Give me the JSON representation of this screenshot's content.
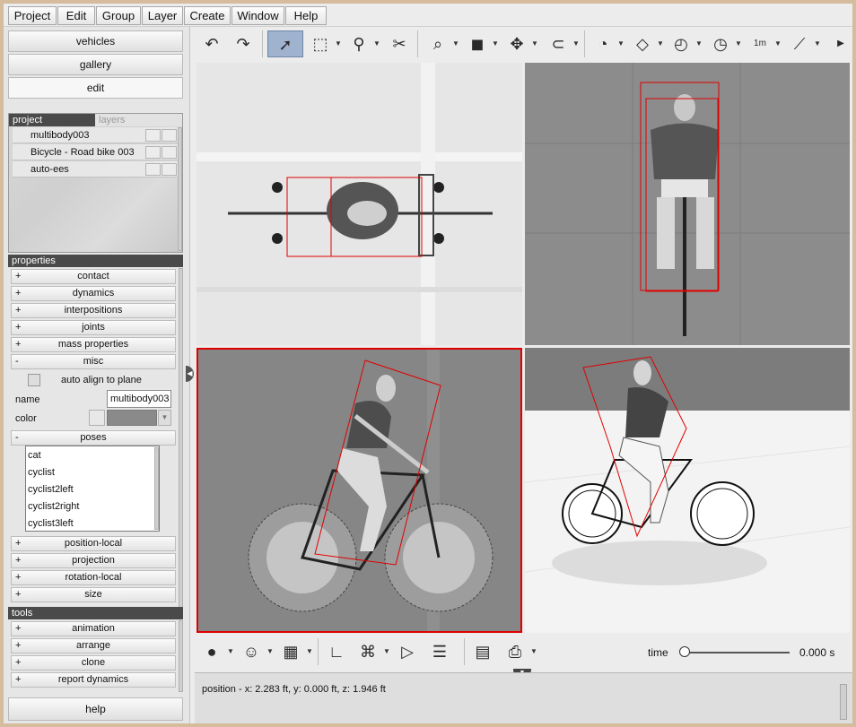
{
  "menubar": {
    "items": [
      "Project",
      "Edit",
      "Group",
      "Layer",
      "Create",
      "Window",
      "Help"
    ]
  },
  "sidebar": {
    "nav": [
      "vehicles",
      "gallery",
      "edit"
    ],
    "project_tabs": [
      "project",
      "layers"
    ],
    "project_items": [
      "multibody003",
      "Bicycle - Road bike 003",
      "auto-ees"
    ],
    "properties_header": "properties",
    "properties": [
      {
        "sign": "+",
        "label": "contact"
      },
      {
        "sign": "+",
        "label": "dynamics"
      },
      {
        "sign": "+",
        "label": "interpositions"
      },
      {
        "sign": "+",
        "label": "joints"
      },
      {
        "sign": "+",
        "label": "mass properties"
      },
      {
        "sign": "-",
        "label": "misc"
      }
    ],
    "misc": {
      "auto_align_label": "auto align to plane",
      "name_label": "name",
      "name_value": "multibody003",
      "color_label": "color"
    },
    "poses_row": {
      "sign": "-",
      "label": "poses"
    },
    "poses": [
      "cat",
      "cyclist",
      "cyclist2left",
      "cyclist2right",
      "cyclist3left"
    ],
    "properties_after": [
      {
        "sign": "+",
        "label": "position-local"
      },
      {
        "sign": "+",
        "label": "projection"
      },
      {
        "sign": "+",
        "label": "rotation-local"
      },
      {
        "sign": "+",
        "label": "size"
      }
    ],
    "tools_header": "tools",
    "tools": [
      {
        "sign": "+",
        "label": "animation"
      },
      {
        "sign": "+",
        "label": "arrange"
      },
      {
        "sign": "+",
        "label": "clone"
      },
      {
        "sign": "+",
        "label": "report dynamics"
      }
    ],
    "help_button": "help"
  },
  "toolbar": {
    "icons": [
      "undo-icon",
      "redo-icon",
      "select-arrow-icon",
      "select-box-icon",
      "branch-icon",
      "scissors-icon",
      "zoom-icon",
      "cube-icon",
      "move-icon",
      "magnet-icon",
      "measure-point-icon",
      "plane-icon",
      "angle-icon",
      "angle2-icon",
      "ruler-icon",
      "tape-icon",
      "more-icon"
    ],
    "ruler_label": "1m"
  },
  "bottom": {
    "time_label": "time",
    "time_value": "0.000 s",
    "time_fraction": 0.0
  },
  "status": {
    "position_text": "position - x: 2.283 ft, y: 0.000 ft, z: 1.946 ft"
  },
  "colors": {
    "selection_red": "#e00000",
    "panel_dark": "#4a4a4a",
    "viewport_gray": "#8a8a8a"
  }
}
